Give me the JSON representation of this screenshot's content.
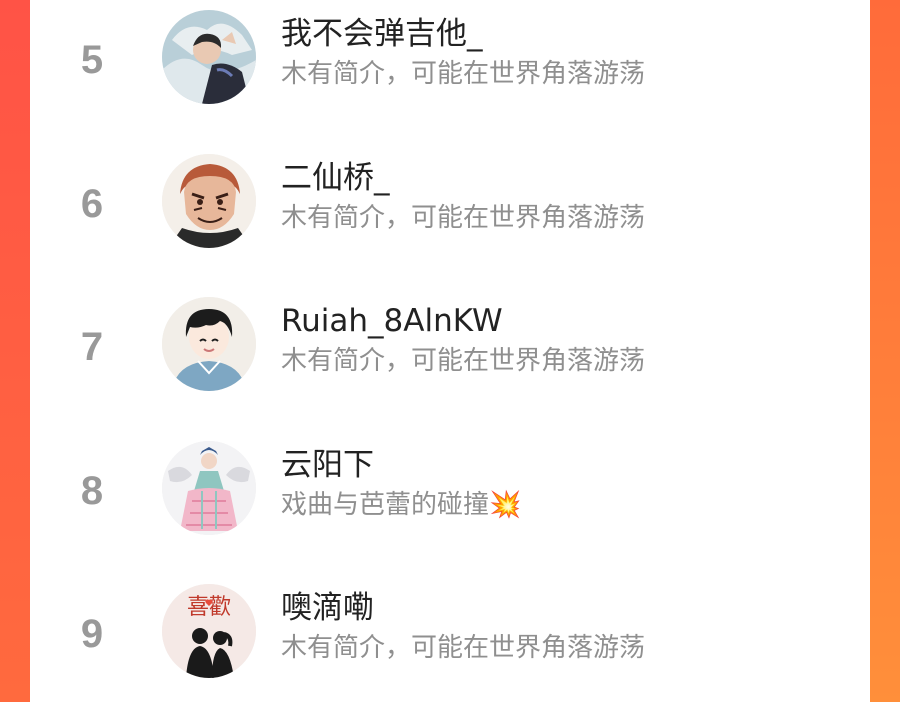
{
  "colors": {
    "background_accent": "#ff6a3c",
    "rank": "#999999",
    "name": "#222222",
    "bio": "#8f8f8f"
  },
  "leaderboard": [
    {
      "rank": "5",
      "name": "我不会弹吉他_",
      "bio": "木有简介，可能在世界角落游荡",
      "avatar": "photo-avatar"
    },
    {
      "rank": "6",
      "name": "二仙桥_",
      "bio": "木有简介，可能在世界角落游荡",
      "avatar": "anime-character-avatar"
    },
    {
      "rank": "7",
      "name": "Ruiah_8AlnKW",
      "bio": "木有简介，可能在世界角落游荡",
      "avatar": "cartoon-boy-avatar"
    },
    {
      "rank": "8",
      "name": "云阳下",
      "bio": "戏曲与芭蕾的碰撞💥",
      "avatar": "opera-costume-avatar"
    },
    {
      "rank": "9",
      "name": "噢滴嘞",
      "bio": "木有简介，可能在世界角落游荡",
      "avatar": "couple-silhouette-avatar",
      "avatar_text": "喜歡"
    }
  ]
}
